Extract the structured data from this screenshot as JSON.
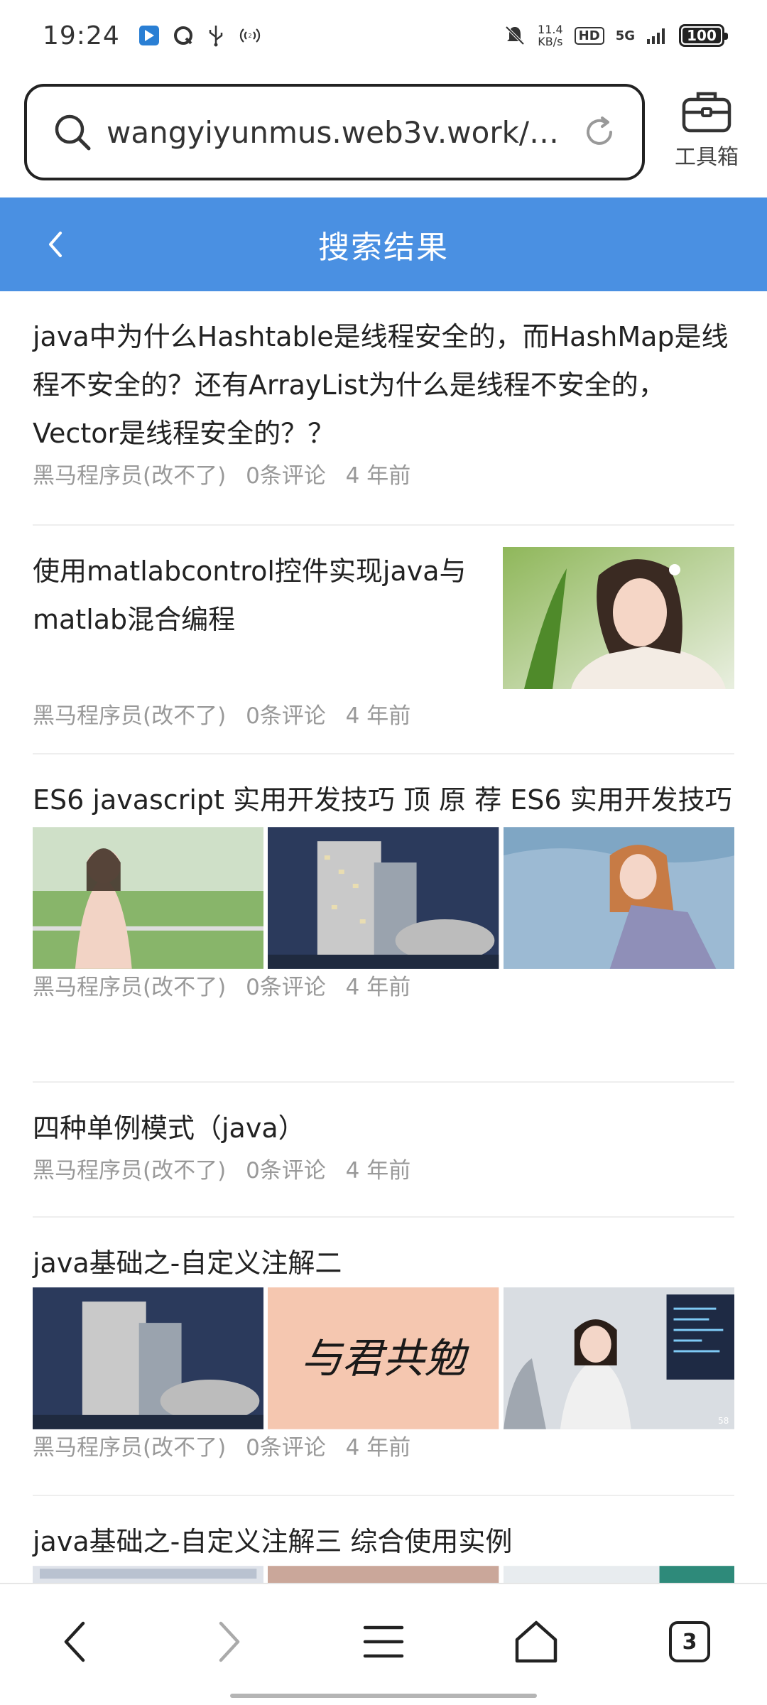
{
  "status_bar": {
    "time": "19:24",
    "net_speed_value": "11.4",
    "net_speed_unit": "KB/s",
    "hd_badge": "HD",
    "signal_label": "5G",
    "battery": "100",
    "battery_level": 1.0,
    "icons": [
      "app-notification-icon",
      "browser-icon",
      "usb-icon",
      "hotspot-icon",
      "mute-bell-icon",
      "signal-bars-icon"
    ]
  },
  "address_bar": {
    "url": "wangyiyunmus.web3v.work/…",
    "toolbox_label": "工具箱"
  },
  "header": {
    "title": "搜索结果",
    "accent_color": "#4a90e2"
  },
  "articles": [
    {
      "title": "java中为什么Hashtable是线程安全的，而HashMap是线程不安全的？还有ArrayList为什么是线程不安全的，Vector是线程安全的？？",
      "author": "黑马程序员(改不了)",
      "comments": "0条评论",
      "time": "4 年前"
    },
    {
      "title": "使用matlabcontrol控件实现java与matlab混合编程",
      "author": "黑马程序员(改不了)",
      "comments": "0条评论",
      "time": "4 年前"
    },
    {
      "title": "ES6 javascript 实用开发技巧 顶 原 荐 ES6 实用开发技巧",
      "author": "黑马程序员(改不了)",
      "comments": "0条评论",
      "time": "4 年前"
    },
    {
      "title": "四种单例模式（java）",
      "author": "黑马程序员(改不了)",
      "comments": "0条评论",
      "time": "4 年前"
    },
    {
      "title": "java基础之-自定义注解二",
      "author": "黑马程序员(改不了)",
      "comments": "0条评论",
      "time": "4 年前",
      "calligraphy_text": "与君共勉",
      "watermark": "58"
    },
    {
      "title": "java基础之-自定义注解三 综合使用实例"
    }
  ],
  "bottom_nav": {
    "tab_count": "3"
  }
}
